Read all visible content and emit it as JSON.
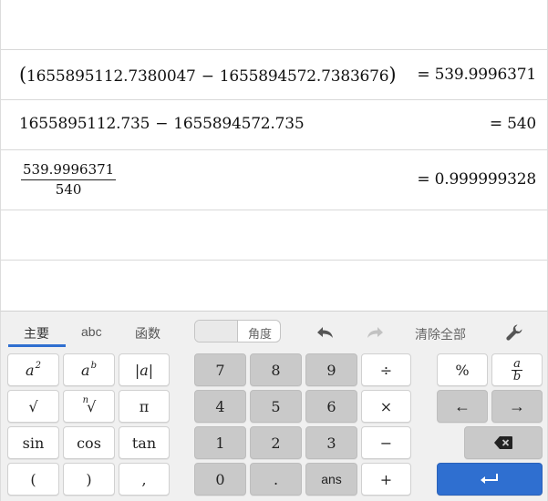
{
  "expressions": [
    {
      "open_paren": "(",
      "a": "1655895112.7380047",
      "op": "−",
      "b": "1655894572.7383676",
      "close_paren": ")",
      "result": "= 539.9996371"
    },
    {
      "a": "1655895112.735",
      "op": "−",
      "b": "1655894572.735",
      "result": "= 540"
    },
    {
      "numerator": "539.9996371",
      "denominator": "540",
      "result": "= 0.999999328"
    }
  ],
  "keypad": {
    "tabs": [
      "主要",
      "abc",
      "函数"
    ],
    "active_tab": "主要",
    "toggle_label": "角度",
    "clear_all": "清除全部",
    "keys": {
      "square_base": "a",
      "square_exp": "2",
      "power_base": "a",
      "power_exp": "b",
      "abs": "|a|",
      "sqrt": "√",
      "nthroot_index": "n",
      "nthroot": "√",
      "pi": "π",
      "sin": "sin",
      "cos": "cos",
      "tan": "tan",
      "lparen": "(",
      "rparen": ")",
      "comma": ",",
      "d7": "7",
      "d8": "8",
      "d9": "9",
      "d4": "4",
      "d5": "5",
      "d6": "6",
      "d1": "1",
      "d2": "2",
      "d3": "3",
      "d0": "0",
      "dot": ".",
      "ans": "ans",
      "divide": "÷",
      "times": "×",
      "minus": "−",
      "plus": "+",
      "percent": "%",
      "frac_num": "a",
      "frac_den": "b",
      "left": "←",
      "right": "→"
    },
    "icons": {
      "undo": "undo-icon",
      "redo": "redo-icon",
      "settings": "wrench-icon",
      "backspace": "backspace-icon",
      "enter": "enter-icon"
    },
    "colors": {
      "accent": "#2f6fd0",
      "gray_key": "#c9c9c9",
      "panel": "#f0f0f0"
    }
  }
}
